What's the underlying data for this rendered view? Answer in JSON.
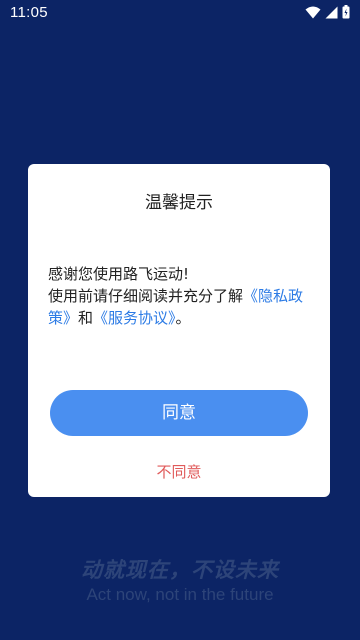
{
  "status_bar": {
    "time": "11:05",
    "icons": [
      "wifi-icon",
      "signal-icon",
      "battery-icon"
    ]
  },
  "dialog": {
    "title": "温馨提示",
    "body": {
      "line1": "感谢您使用路飞运动!",
      "line2_prefix": "使用前请仔细阅读并充分了解",
      "privacy_link": "《隐私政策》",
      "conjunction": "和",
      "service_link": "《服务协议》",
      "end": "。"
    },
    "agree_label": "同意",
    "disagree_label": "不同意"
  },
  "footer": {
    "slogan_cn": "动就现在，不设未来",
    "slogan_en": "Act now, not in the future"
  },
  "colors": {
    "background": "#0c2465",
    "accent": "#4a8ff0",
    "link": "#2c7be5",
    "danger": "#e05a5a",
    "slogan": "#2d4479"
  }
}
